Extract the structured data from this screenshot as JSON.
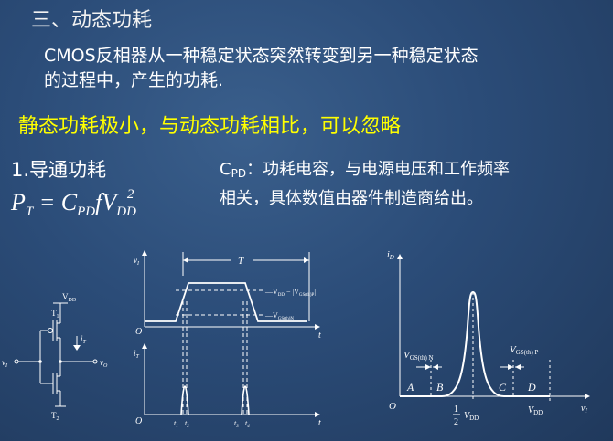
{
  "section_title": "三、动态功耗",
  "intro_line1": "CMOS反相器从一种稳定状态突然转变到另一种稳定状态",
  "intro_line2": "的过程中，产生的功耗.",
  "highlight": "静态功耗极小，与动态功耗相比，可以忽略",
  "subheading": "1.导通功耗",
  "formula": {
    "lhs": "P",
    "lhs_sub": "T",
    "eq": " = C",
    "c_sub": "PD",
    "f": "fV",
    "v_sub": "DD",
    "v_sup": "2"
  },
  "cpd_note": {
    "symbol": "C",
    "symbol_sub": "PD",
    "line1_rest": "：功耗电容，与电源电压和工作频率",
    "line2": "相关，具体数值由器件制造商给出。"
  },
  "circuit": {
    "vdd": "V",
    "vdd_sub": "DD",
    "t1": "T",
    "t1_sub": "1",
    "t2": "T",
    "t2_sub": "2",
    "vi": "v",
    "vi_sub": "I",
    "vo": "v",
    "vo_sub": "O",
    "it": "i",
    "it_sub": "T"
  },
  "waveform": {
    "vi_axis": "v",
    "vi_axis_sub": "I",
    "it_axis": "i",
    "it_axis_sub": "T",
    "period": "T",
    "level_high": "V",
    "level_high_sub": "DD",
    "level_high_rest": " − |V",
    "level_high_rest_sub": "GS(th)P",
    "level_low": "V",
    "level_low_sub": "GS(th)N",
    "origin_top": "O",
    "origin_bottom": "O",
    "t_axis_top": "t",
    "t_axis_bottom": "t",
    "t1": "t",
    "t1_sub": "1",
    "t2": "t",
    "t2_sub": "2",
    "t3": "t",
    "t3_sub": "3",
    "t4": "t",
    "t4_sub": "4"
  },
  "transfer": {
    "id_axis": "i",
    "id_axis_sub": "D",
    "vi_axis": "v",
    "vi_axis_sub": "I",
    "origin": "O",
    "vgsn": "V",
    "vgsn_sub": "GS(th) N",
    "vgsp": "V",
    "vgsp_sub": "GS(th) P",
    "region_a": "A",
    "region_b": "B",
    "region_c": "C",
    "region_d": "D",
    "half_num": "1",
    "half_den": "2",
    "half_v": "V",
    "half_v_sub": "DD",
    "vdd": "V",
    "vdd_sub": "DD"
  }
}
